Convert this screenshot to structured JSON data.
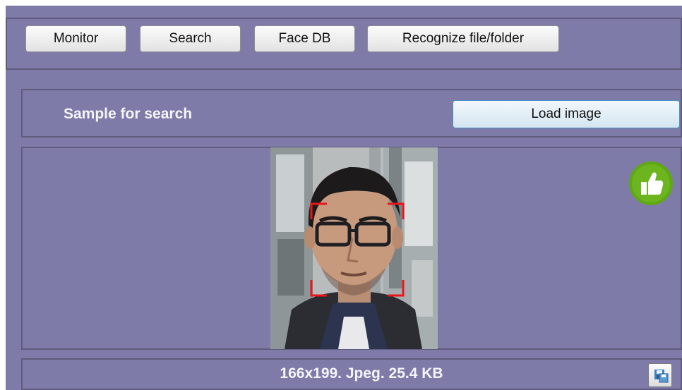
{
  "toolbar": {
    "buttons": [
      {
        "label": "Monitor"
      },
      {
        "label": "Search"
      },
      {
        "label": "Face DB"
      },
      {
        "label": "Recognize file/folder"
      }
    ]
  },
  "sample": {
    "title": "Sample for search",
    "load_button_label": "Load image"
  },
  "image": {
    "status_icon": "thumbs-up-icon",
    "status_color": "#5fa814",
    "face_box_color": "#e8151b"
  },
  "info": {
    "text": "166x199. Jpeg. 25.4 KB",
    "save_icon": "save-icon"
  }
}
